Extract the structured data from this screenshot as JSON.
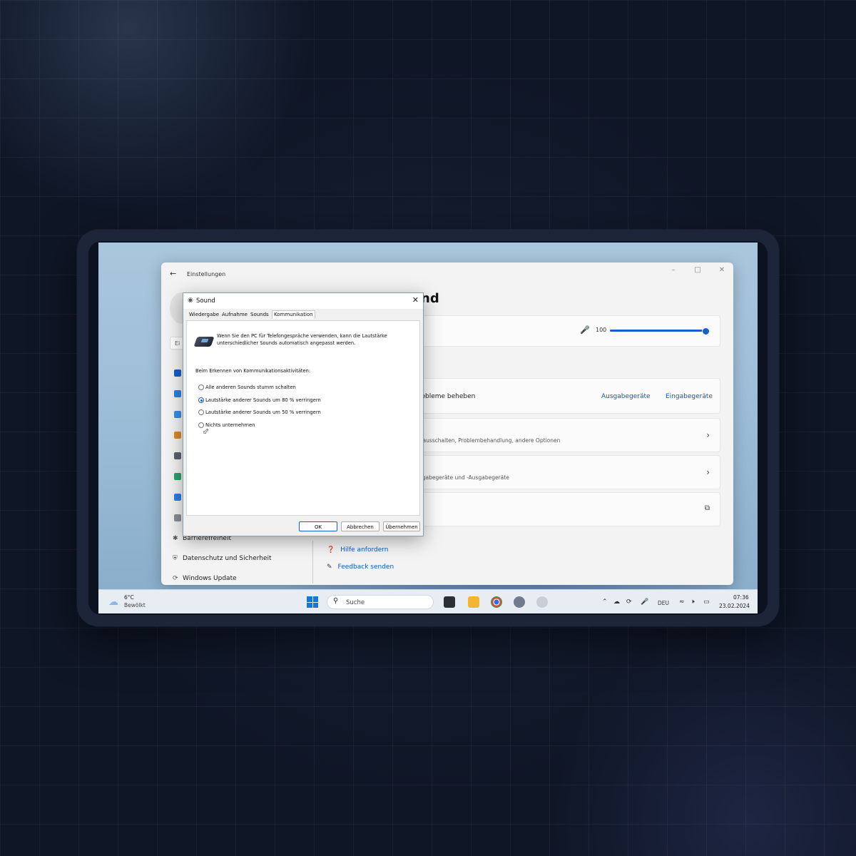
{
  "settings": {
    "app_title": "Einstellungen",
    "search_placeholder": "Ei",
    "page_title_tail": "nd",
    "input_volume": "100",
    "input_volume_level": 1.0,
    "troubleshoot_label": "robleme beheben",
    "output_devices_link": "Ausgabegeräte",
    "input_devices_link": "Eingabegeräte",
    "more_options_sub": "r ausschalten, Problembehandlung, andere Optionen",
    "all_devices_sub": "ngabegeräte und -Ausgabegeräte",
    "more_settings_tail": "n",
    "nav": [
      {
        "label": "Barrierefreiheit"
      },
      {
        "label": "Datenschutz und Sicherheit"
      },
      {
        "label": "Windows Update"
      }
    ],
    "help_link": "Hilfe anfordern",
    "feedback_link": "Feedback senden"
  },
  "dialog": {
    "title": "Sound",
    "tabs": [
      "Wiedergabe",
      "Aufnahme",
      "Sounds",
      "Kommunikation"
    ],
    "intro": "Wenn Sie den PC für Telefongespräche verwenden, kann die Lautstärke unterschiedlicher Sounds automatisch angepasst werden.",
    "group_label": "Beim Erkennen von Kommunikationsaktivitäten:",
    "options": [
      "Alle anderen Sounds stumm schalten",
      "Lautstärke anderer Sounds um 80 % verringern",
      "Lautstärke anderer Sounds um 50 % verringern",
      "Nichts unternehmen"
    ],
    "ok": "OK",
    "cancel": "Abbrechen",
    "apply": "Übernehmen"
  },
  "taskbar": {
    "temperature": "6°C",
    "condition": "Bewölkt",
    "search": "Suche",
    "language": "DEU",
    "time": "07:36",
    "date": "23.02.2024"
  },
  "colors": {
    "accent": "#1a5fc9",
    "link": "#0a5ac2"
  }
}
